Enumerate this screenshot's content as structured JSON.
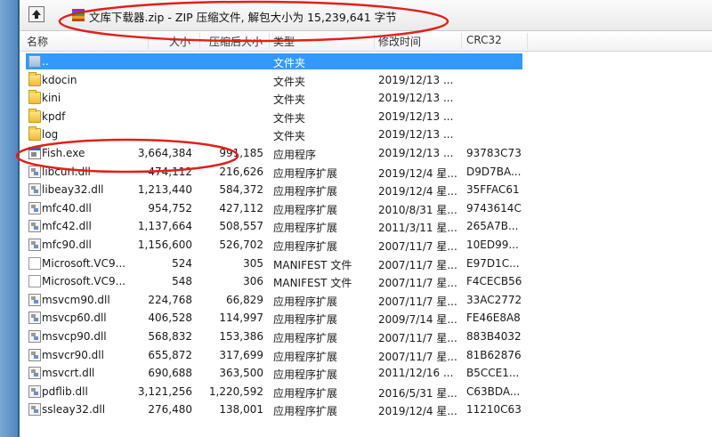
{
  "path_bar": {
    "title": "文库下载器.zip - ZIP 压缩文件, 解包大小为 15,239,641 字节"
  },
  "columns": {
    "name": "名称",
    "size": "大小",
    "packed": "压缩后大小",
    "type": "类型",
    "modified": "修改时间",
    "crc": "CRC32"
  },
  "rows": [
    {
      "name": "..",
      "size": "",
      "packed": "",
      "type": "文件夹",
      "modified": "",
      "crc": "",
      "icon": "updir-icon"
    },
    {
      "name": "kdocin",
      "size": "",
      "packed": "",
      "type": "文件夹",
      "modified": "2019/12/13 ...",
      "crc": "",
      "icon": "folder-icon"
    },
    {
      "name": "kini",
      "size": "",
      "packed": "",
      "type": "文件夹",
      "modified": "2019/12/13 ...",
      "crc": "",
      "icon": "folder-icon"
    },
    {
      "name": "kpdf",
      "size": "",
      "packed": "",
      "type": "文件夹",
      "modified": "2019/12/13 ...",
      "crc": "",
      "icon": "folder-icon"
    },
    {
      "name": "log",
      "size": "",
      "packed": "",
      "type": "文件夹",
      "modified": "2019/12/13 ...",
      "crc": "",
      "icon": "folder-icon"
    },
    {
      "name": "Fish.exe",
      "size": "3,664,384",
      "packed": "991,185",
      "type": "应用程序",
      "modified": "2019/12/13 ...",
      "crc": "93783C73",
      "icon": "exe-icon"
    },
    {
      "name": "libcurl.dll",
      "size": "474,112",
      "packed": "216,626",
      "type": "应用程序扩展",
      "modified": "2019/12/4 星...",
      "crc": "D9D7BA...",
      "icon": "dll-icon"
    },
    {
      "name": "libeay32.dll",
      "size": "1,213,440",
      "packed": "584,372",
      "type": "应用程序扩展",
      "modified": "2019/12/4 星...",
      "crc": "35FFAC61",
      "icon": "dll-icon"
    },
    {
      "name": "mfc40.dll",
      "size": "954,752",
      "packed": "427,112",
      "type": "应用程序扩展",
      "modified": "2010/8/31 星...",
      "crc": "9743614C",
      "icon": "dll-icon"
    },
    {
      "name": "mfc42.dll",
      "size": "1,137,664",
      "packed": "508,557",
      "type": "应用程序扩展",
      "modified": "2011/3/11 星...",
      "crc": "265A7B...",
      "icon": "dll-icon"
    },
    {
      "name": "mfc90.dll",
      "size": "1,156,600",
      "packed": "526,702",
      "type": "应用程序扩展",
      "modified": "2007/11/7 星...",
      "crc": "10ED99...",
      "icon": "dll-icon"
    },
    {
      "name": "Microsoft.VC9...",
      "size": "524",
      "packed": "305",
      "type": "MANIFEST 文件",
      "modified": "2007/11/7 星...",
      "crc": "E97D1C...",
      "icon": "file-icon"
    },
    {
      "name": "Microsoft.VC9...",
      "size": "548",
      "packed": "306",
      "type": "MANIFEST 文件",
      "modified": "2007/11/7 星...",
      "crc": "F4CECB56",
      "icon": "file-icon"
    },
    {
      "name": "msvcm90.dll",
      "size": "224,768",
      "packed": "66,829",
      "type": "应用程序扩展",
      "modified": "2007/11/7 星...",
      "crc": "33AC2772",
      "icon": "dll-icon"
    },
    {
      "name": "msvcp60.dll",
      "size": "406,528",
      "packed": "114,997",
      "type": "应用程序扩展",
      "modified": "2009/7/14 星...",
      "crc": "FE46E8A8",
      "icon": "dll-icon"
    },
    {
      "name": "msvcp90.dll",
      "size": "568,832",
      "packed": "153,386",
      "type": "应用程序扩展",
      "modified": "2007/11/7 星...",
      "crc": "883B4032",
      "icon": "dll-icon"
    },
    {
      "name": "msvcr90.dll",
      "size": "655,872",
      "packed": "317,699",
      "type": "应用程序扩展",
      "modified": "2007/11/7 星...",
      "crc": "81B62876",
      "icon": "dll-icon"
    },
    {
      "name": "msvcrt.dll",
      "size": "690,688",
      "packed": "363,500",
      "type": "应用程序扩展",
      "modified": "2011/12/16 ...",
      "crc": "B5CCE1...",
      "icon": "dll-icon"
    },
    {
      "name": "pdflib.dll",
      "size": "3,121,256",
      "packed": "1,220,592",
      "type": "应用程序扩展",
      "modified": "2016/5/31 星...",
      "crc": "C63BDA...",
      "icon": "dll-icon"
    },
    {
      "name": "ssleay32.dll",
      "size": "276,480",
      "packed": "138,001",
      "type": "应用程序扩展",
      "modified": "2019/12/4 星...",
      "crc": "11210C63",
      "icon": "dll-icon"
    }
  ],
  "colors": {
    "selection": "#3399ff",
    "annotation": "#e0201c"
  }
}
